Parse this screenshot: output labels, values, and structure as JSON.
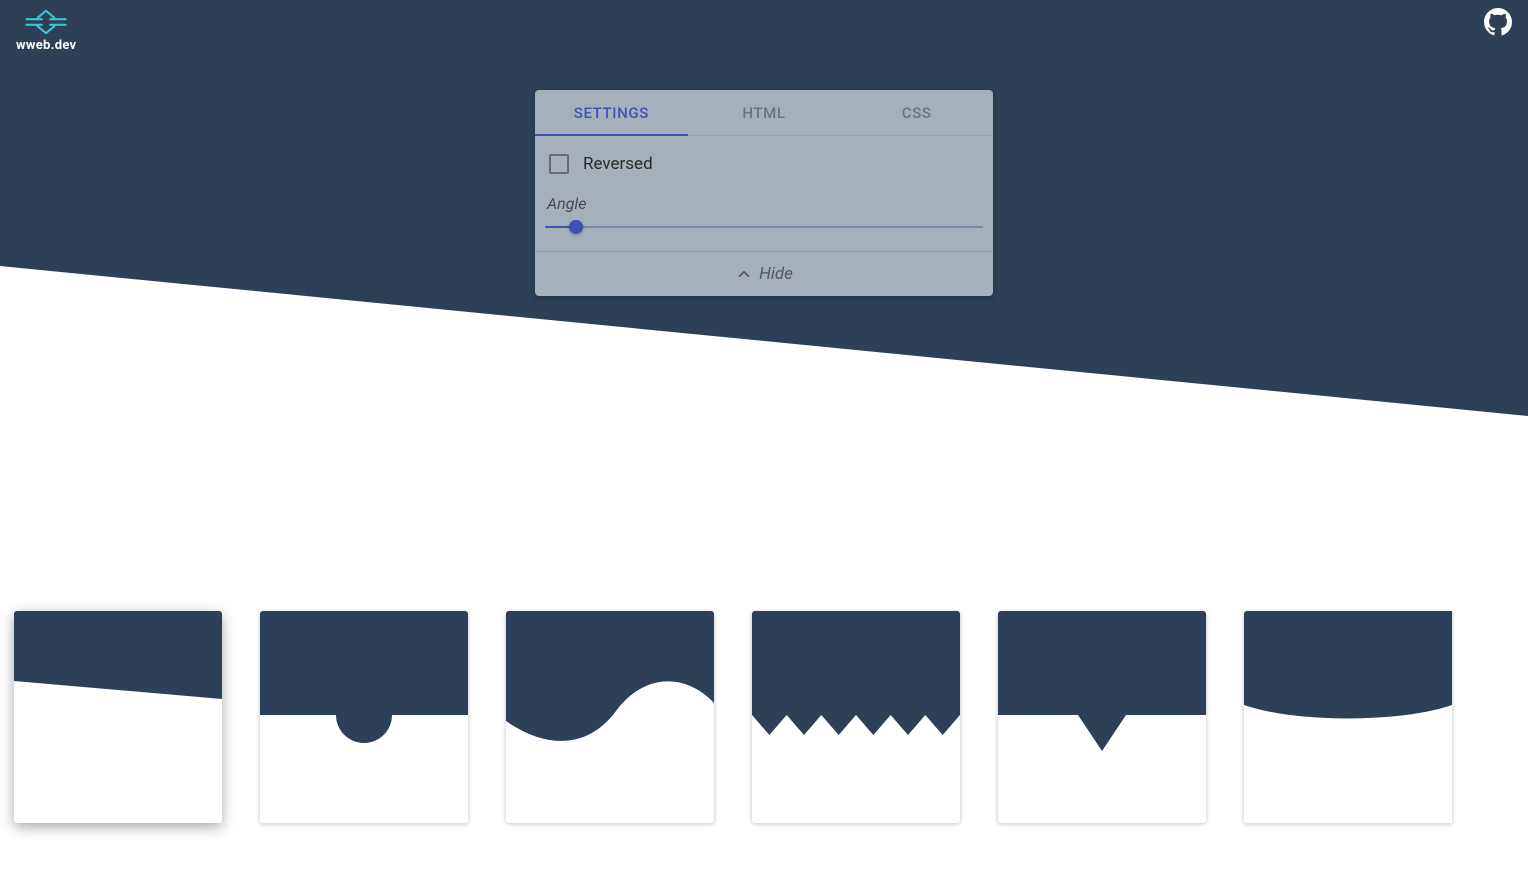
{
  "brand": {
    "name": "wweb.dev"
  },
  "colors": {
    "primary": "#2e4057",
    "accent": "#3f51b5",
    "logo_accent": "#3bc4d6"
  },
  "tabs": {
    "settings": "SETTINGS",
    "html": "HTML",
    "css": "CSS",
    "active": "settings"
  },
  "settings": {
    "reversed_label": "Reversed",
    "reversed_checked": false,
    "angle_label": "Angle",
    "angle_percent": 7
  },
  "hide_label": "Hide",
  "thumbnails": [
    {
      "id": "skew",
      "active": true
    },
    {
      "id": "semi-circle",
      "active": false
    },
    {
      "id": "wave",
      "active": false
    },
    {
      "id": "zigzag",
      "active": false
    },
    {
      "id": "triangle",
      "active": false
    },
    {
      "id": "curve",
      "active": false
    }
  ]
}
